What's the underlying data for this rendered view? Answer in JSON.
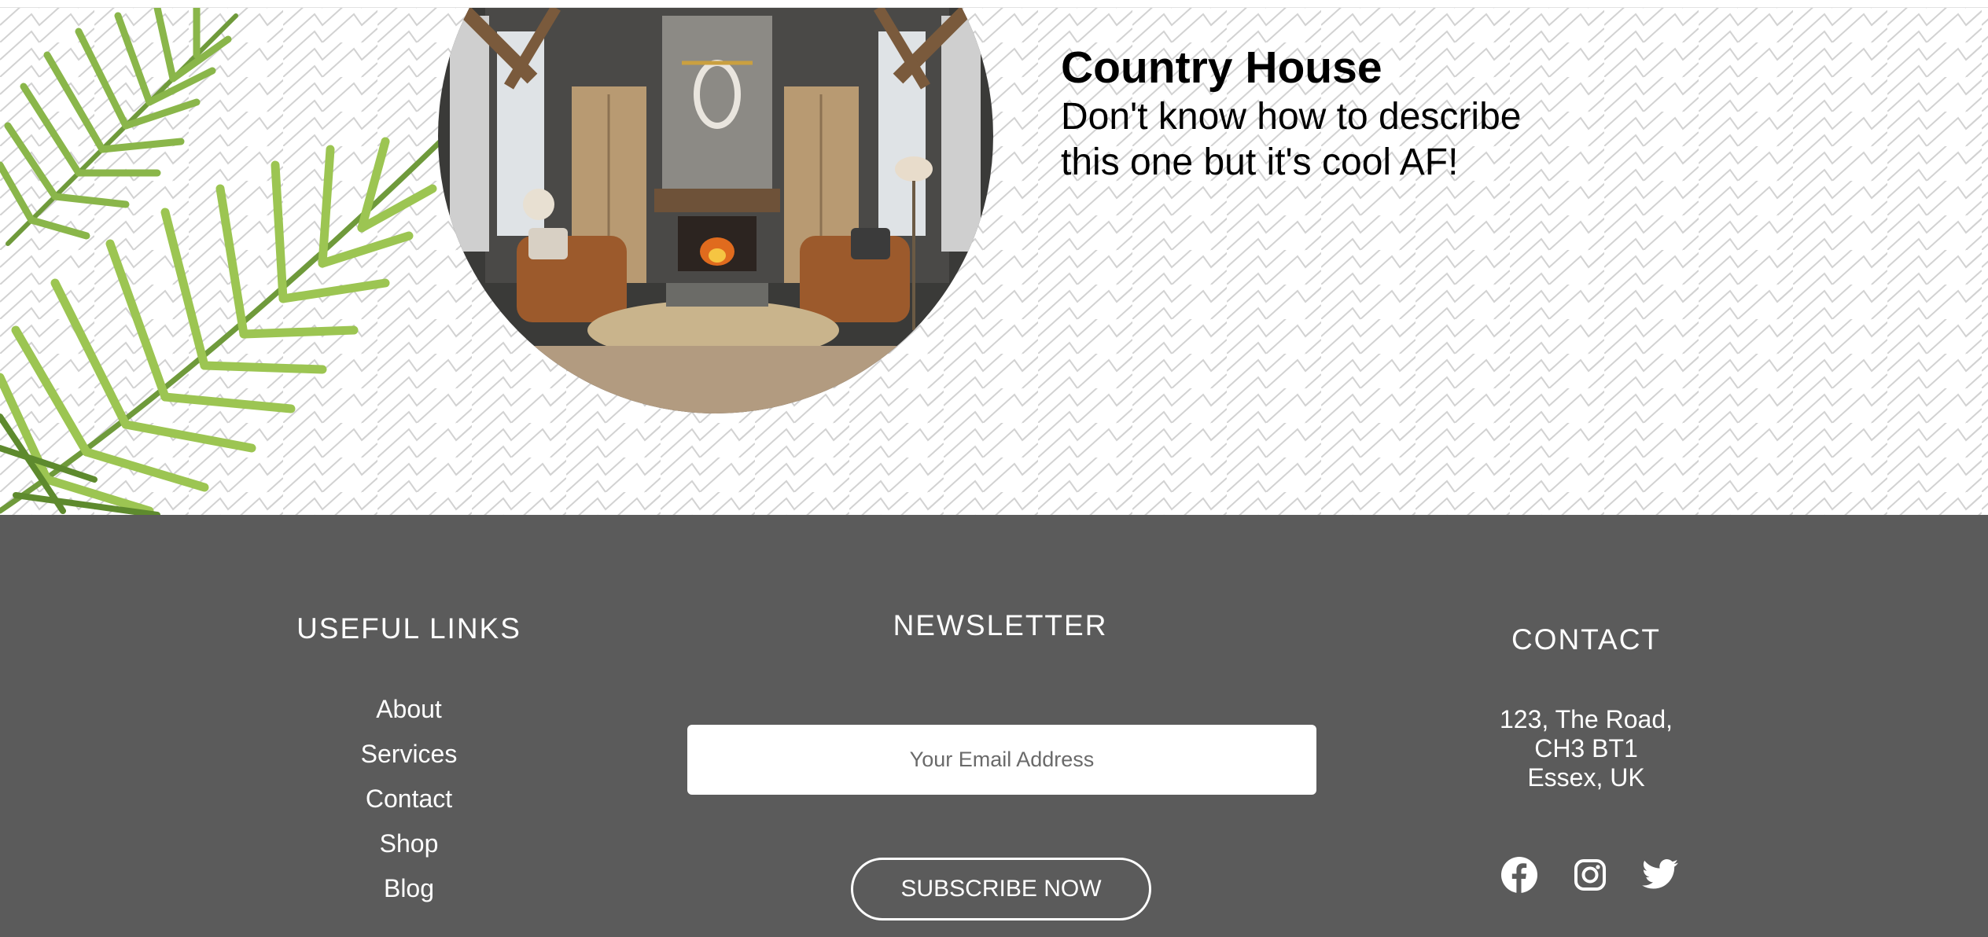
{
  "hero": {
    "title": "Country House",
    "description_line1": "Don't know how to describe",
    "description_line2": "this one but it's cool AF!",
    "image_alt": "Rustic living room with stone fireplace and leather armchairs"
  },
  "footer": {
    "background_color": "#5b5b5b",
    "useful_links": {
      "heading": "USEFUL LINKS",
      "items": [
        {
          "label": "About"
        },
        {
          "label": "Services"
        },
        {
          "label": "Contact"
        },
        {
          "label": "Shop"
        },
        {
          "label": "Blog"
        }
      ]
    },
    "newsletter": {
      "heading": "NEWSLETTER",
      "email_placeholder": "Your Email Address",
      "email_value": "",
      "subscribe_label": "SUBSCRIBE NOW"
    },
    "contact": {
      "heading": "CONTACT",
      "address_line1": "123, The Road,",
      "address_line2": "CH3 BT1",
      "address_line3": "Essex, UK",
      "social": [
        {
          "icon": "facebook-icon"
        },
        {
          "icon": "instagram-icon"
        },
        {
          "icon": "twitter-icon"
        }
      ]
    }
  }
}
